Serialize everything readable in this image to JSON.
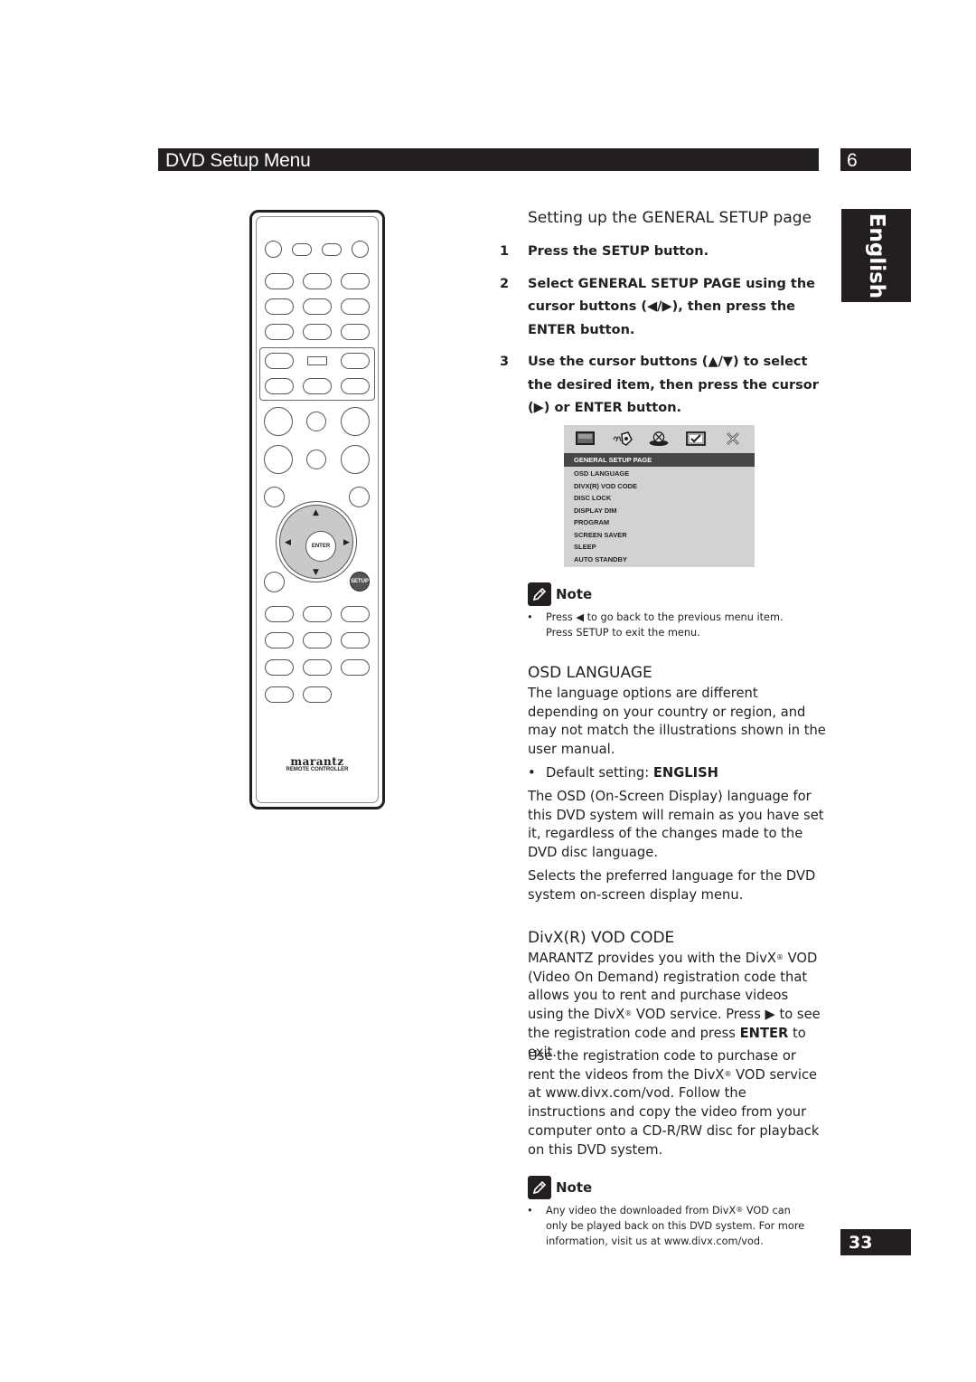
{
  "header": {
    "section_title": "DVD Setup Menu",
    "chapter_number": "6",
    "language_tab": "English",
    "page_number": "33"
  },
  "remote": {
    "brand": "marantz",
    "subtitle": "REMOTE CONTROLLER",
    "enter_label": "ENTER",
    "setup_label": "SETUP",
    "arrows": {
      "up": "▲",
      "down": "▼",
      "left": "◀",
      "right": "▶"
    }
  },
  "general_setup": {
    "heading": "Setting up the GENERAL SETUP page",
    "steps": [
      {
        "num": "1",
        "text": "Press the SETUP button."
      },
      {
        "num": "2",
        "text": "Select GENERAL SETUP PAGE using the cursor buttons (◀/▶), then press the ENTER button."
      },
      {
        "num": "3",
        "text": "Use the cursor buttons (▲/▼) to select the desired item, then press the cursor (▶) or ENTER button."
      }
    ]
  },
  "osd_menu": {
    "icons": [
      "general-setup-icon",
      "audio-setup-icon",
      "video-setup-icon",
      "preference-icon",
      "exit-icon"
    ],
    "selected": "GENERAL SETUP PAGE",
    "items": [
      "OSD LANGUAGE",
      "DIVX(R) VOD CODE",
      "DISC LOCK",
      "DISPLAY DIM",
      "PROGRAM",
      "SCREEN SAVER",
      "SLEEP",
      "AUTO STANDBY"
    ]
  },
  "note1": {
    "heading": "Note",
    "bullet": "•",
    "line1": "Press ◀ to go back to the previous menu item.",
    "line2": "Press SETUP to exit the menu."
  },
  "osd_language": {
    "heading": "OSD LANGUAGE",
    "para1": "The language options are different depending on your country or region, and may not match the illustrations shown in the user manual.",
    "default_prefix": "Default setting: ",
    "default_value": "ENGLISH",
    "para2": "The OSD (On-Screen Display) language for this DVD system will remain as you have set it, regardless of the changes made to the DVD disc language.",
    "para3": "Selects the preferred language for the DVD system on-screen display menu."
  },
  "divx_vod": {
    "heading": "DivX(R) VOD CODE",
    "para1_a": "MARANTZ provides you with the DivX",
    "reg": "®",
    "para1_b": " VOD (Video On Demand) registration code that allows you to rent and purchase videos using the DivX",
    "para1_c": " VOD service. Press ▶ to see the registration code and press ",
    "para1_bold": "ENTER",
    "para1_d": " to exit.",
    "para2_a": "Use the registration code to purchase or rent the videos from the DivX",
    "para2_b": " VOD service at www.divx.com/vod. Follow the instructions and copy the video from your computer onto a CD-R/RW disc for playback on this DVD system."
  },
  "note2": {
    "heading": "Note",
    "bullet": "•",
    "line1_a": "Any video the downloaded from DivX",
    "reg": "®",
    "line1_b": " VOD can",
    "line2": "only be played back on this DVD system. For more",
    "line3": "information, visit us at www.divx.com/vod."
  }
}
